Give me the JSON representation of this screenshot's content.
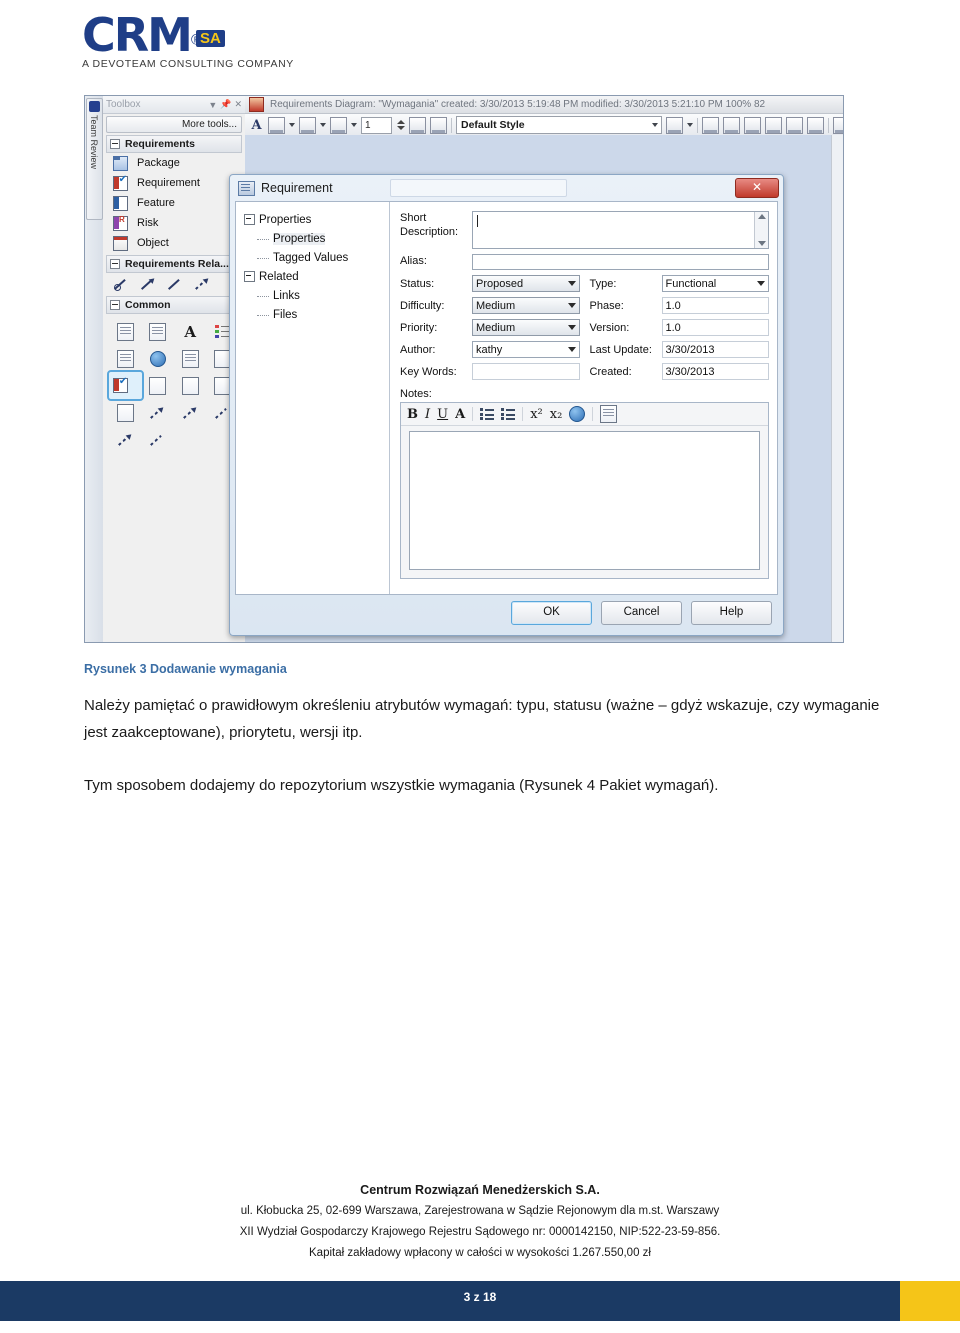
{
  "logo": {
    "brand": "CRM",
    "registered": "®",
    "sa": "SA",
    "tagline": "A DEVOTEAM CONSULTING COMPANY",
    "brand_color": "#1f3e87",
    "accent_color": "#f5c518"
  },
  "screenshot": {
    "left_rail": {
      "tab_label": "Team Review"
    },
    "toolbox": {
      "header_title": "Toolbox",
      "more_tools": "More tools...",
      "sections": [
        {
          "title": "Requirements",
          "items": [
            {
              "label": "Package",
              "icon": "package-icon"
            },
            {
              "label": "Requirement",
              "icon": "requirement-icon"
            },
            {
              "label": "Feature",
              "icon": "feature-icon"
            },
            {
              "label": "Risk",
              "icon": "risk-icon"
            },
            {
              "label": "Object",
              "icon": "object-icon"
            }
          ]
        },
        {
          "title": "Requirements Rela...",
          "items": []
        },
        {
          "title": "Common",
          "items": []
        }
      ]
    },
    "diagram": {
      "title": "Requirements Diagram: \"Wymagania\"  created: 3/30/2013 5:19:48 PM  modified: 3/30/2013 5:21:10 PM   100%   82",
      "toolbar": {
        "font_size": "1",
        "style_name": "Default Style"
      }
    },
    "dialog": {
      "title": "Requirement",
      "close_label": "✕",
      "tree": [
        {
          "label": "Properties",
          "type": "root"
        },
        {
          "label": "Properties",
          "type": "child",
          "selected": true
        },
        {
          "label": "Tagged Values",
          "type": "child"
        },
        {
          "label": "Related",
          "type": "root"
        },
        {
          "label": "Links",
          "type": "child"
        },
        {
          "label": "Files",
          "type": "child"
        }
      ],
      "fields": {
        "short_description_label": "Short Description:",
        "short_description_value": "",
        "alias_label": "Alias:",
        "alias_value": "",
        "status_label": "Status:",
        "status_value": "Proposed",
        "type_label": "Type:",
        "type_value": "Functional",
        "difficulty_label": "Difficulty:",
        "difficulty_value": "Medium",
        "phase_label": "Phase:",
        "phase_value": "1.0",
        "priority_label": "Priority:",
        "priority_value": "Medium",
        "version_label": "Version:",
        "version_value": "1.0",
        "author_label": "Author:",
        "author_value": "kathy",
        "last_update_label": "Last Update:",
        "last_update_value": "3/30/2013",
        "key_words_label": "Key Words:",
        "key_words_value": "",
        "created_label": "Created:",
        "created_value": "3/30/2013",
        "notes_label": "Notes:",
        "notes_value": ""
      },
      "notes_toolbar": [
        "B",
        "I",
        "U",
        "A"
      ],
      "buttons": {
        "ok": "OK",
        "cancel": "Cancel",
        "help": "Help"
      }
    }
  },
  "document": {
    "figure_caption": "Rysunek 3 Dodawanie wymagania",
    "paragraph_1": "Należy pamiętać o prawidłowym określeniu atrybutów wymagań: typu, statusu (ważne – gdyż wskazuje, czy wymaganie jest zaakceptowane), priorytetu, wersji itp.",
    "paragraph_2": "Tym sposobem dodajemy do repozytorium wszystkie wymagania (Rysunek 4 Pakiet wymagań).",
    "caption_color": "#3b6ea5"
  },
  "footer": {
    "company": "Centrum Rozwiązań Menedżerskich S.A.",
    "line1": "ul. Kłobucka 25, 02-699 Warszawa, Zarejestrowana w Sądzie Rejonowym dla m.st. Warszawy",
    "line2": "XII Wydział Gospodarczy Krajowego Rejestru Sądowego nr: 0000142150, NIP:522-23-59-856.",
    "line3": "Kapitał zakładowy wpłacony w całości w wysokości 1.267.550,00 zł",
    "page_number": "3 z 18",
    "bar_color": "#1b3a64",
    "accent_color": "#f5c518"
  }
}
